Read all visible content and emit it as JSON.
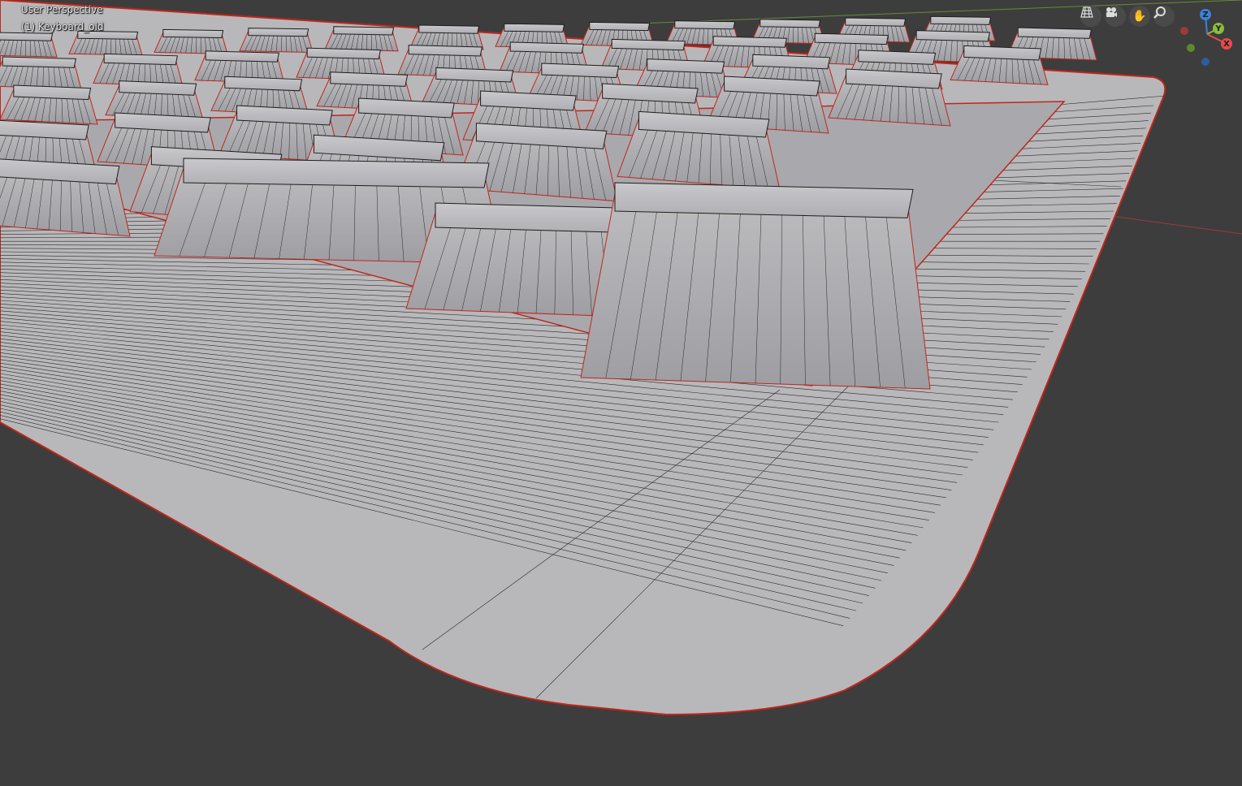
{
  "viewport": {
    "view_name": "User Perspective",
    "object_label": "(1) Keyboard_old",
    "background_color": "#3d3d3d",
    "mesh_color": "#b9b9bc",
    "wire_color": "#1e1e1e",
    "edge_highlight_color": "#c0261a"
  },
  "nav_gizmo": {
    "buttons": [
      {
        "name": "toggle-camera-ortho",
        "icon": "grid-perspective-icon"
      },
      {
        "name": "camera-view",
        "icon": "camera-icon"
      },
      {
        "name": "pan-view",
        "icon": "hand-icon"
      },
      {
        "name": "zoom-view",
        "icon": "magnifier-icon"
      }
    ],
    "axes": {
      "x": "X",
      "y": "Y",
      "z": "Z"
    },
    "axis_colors": {
      "x": "#e84a4a",
      "y": "#8bbd3a",
      "z": "#3a83d9",
      "neg_x": "#9c3b3b",
      "neg_y": "#5c8a2a",
      "neg_z": "#2c5e9e"
    }
  }
}
